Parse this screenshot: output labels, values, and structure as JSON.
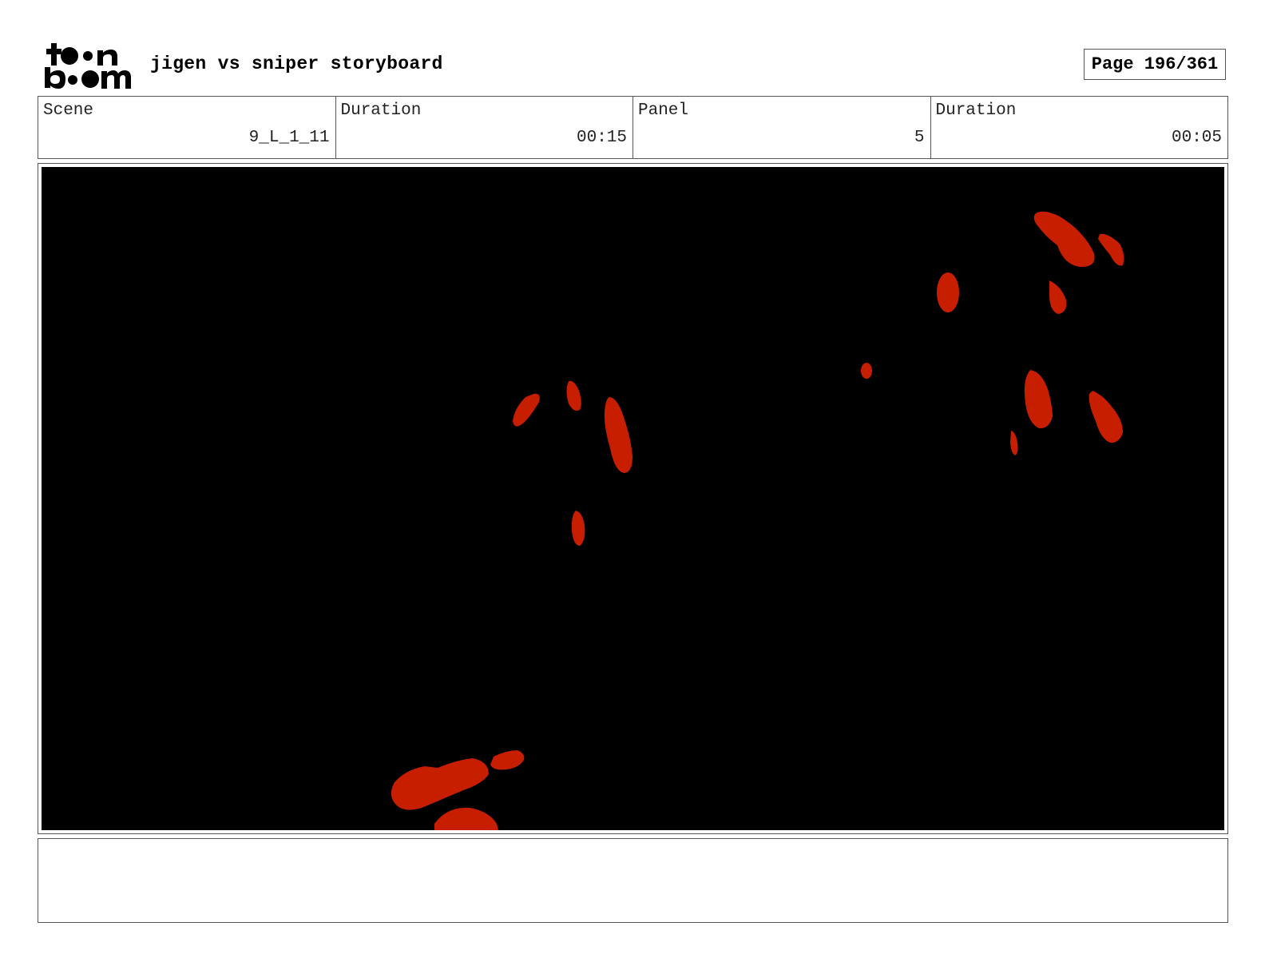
{
  "header": {
    "logo_icon": "toon-boom-logo",
    "project_title": "jigen vs sniper storyboard",
    "page_label": "Page 196/361"
  },
  "info": {
    "scene_label": "Scene",
    "scene_value": "9_L_1_11",
    "scene_duration_label": "Duration",
    "scene_duration_value": "00:15",
    "panel_label": "Panel",
    "panel_value": "5",
    "panel_duration_label": "Duration",
    "panel_duration_value": "00:05"
  },
  "panel": {
    "background_color": "#000000",
    "blood_color": "#c81e00"
  },
  "notes": {
    "action_text": ""
  }
}
